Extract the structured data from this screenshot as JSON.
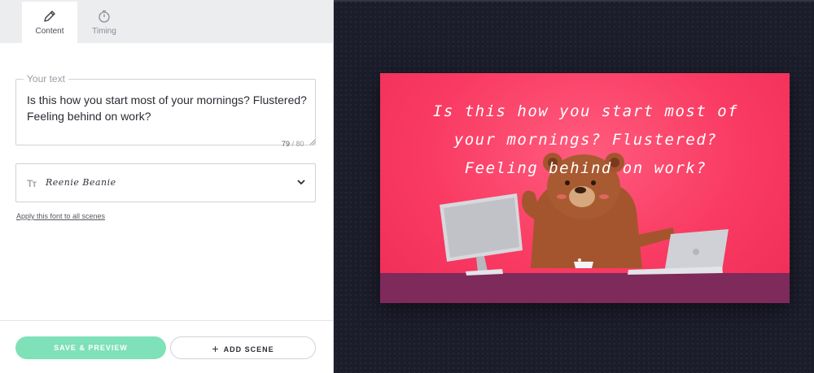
{
  "tabs": [
    {
      "label": "Content",
      "icon": "pencil-icon",
      "active": true
    },
    {
      "label": "Timing",
      "icon": "stopwatch-icon",
      "active": false
    }
  ],
  "text_field": {
    "legend": "Your text",
    "value": "Is this how you start most of your mornings? Flustered? Feeling behind on work?",
    "count": "79",
    "max": " / 80"
  },
  "font_select": {
    "icon": "Tт",
    "value": "Reenie Beanie"
  },
  "apply_font_link": "Apply this font to all scenes",
  "buttons": {
    "save": "SAVE & PREVIEW",
    "add_scene_plus": "+",
    "add_scene": "ADD SCENE"
  },
  "preview": {
    "caption_line1": "Is this how you start most of",
    "caption_line2": "your mornings? Flustered?",
    "caption_line3": "Feeling behind on work?"
  },
  "colors": {
    "accent_green": "#7fe1b8",
    "preview_pink": "#f93a62",
    "desk_purple": "#7e2a5a",
    "dark_bg": "#1c1d2b"
  }
}
